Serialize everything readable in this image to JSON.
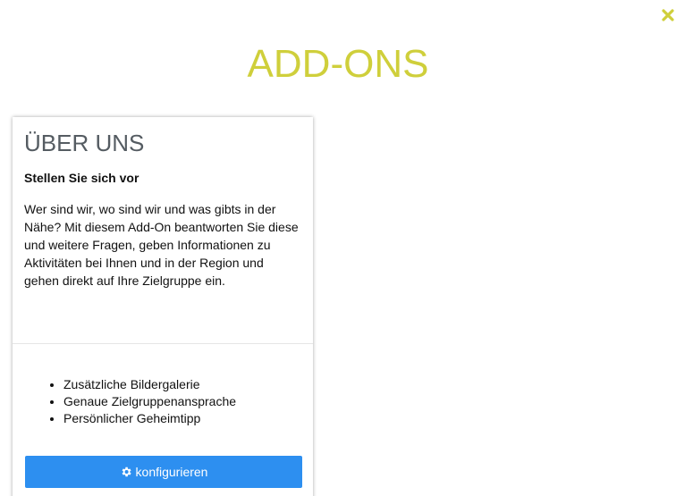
{
  "page": {
    "title": "ADD-ONS",
    "close_icon": "close-icon",
    "accent_color": "#cfcf3b"
  },
  "card": {
    "title": "ÜBER UNS",
    "subtitle": "Stellen Sie sich vor",
    "description": "Wer sind wir, wo sind wir und was gibts in der Nähe? Mit diesem Add-On beantworten Sie diese und weitere Fragen, geben Informationen zu Aktivitäten bei Ihnen und in der Region und gehen direkt auf Ihre Zielgruppe ein.",
    "features": [
      "Zusätzliche Bildergalerie",
      "Genaue Zielgruppenansprache",
      "Persönlicher Geheimtipp"
    ],
    "button_label": "konfigurieren",
    "button_icon": "gear-icon",
    "button_color": "#2d8ff0"
  }
}
